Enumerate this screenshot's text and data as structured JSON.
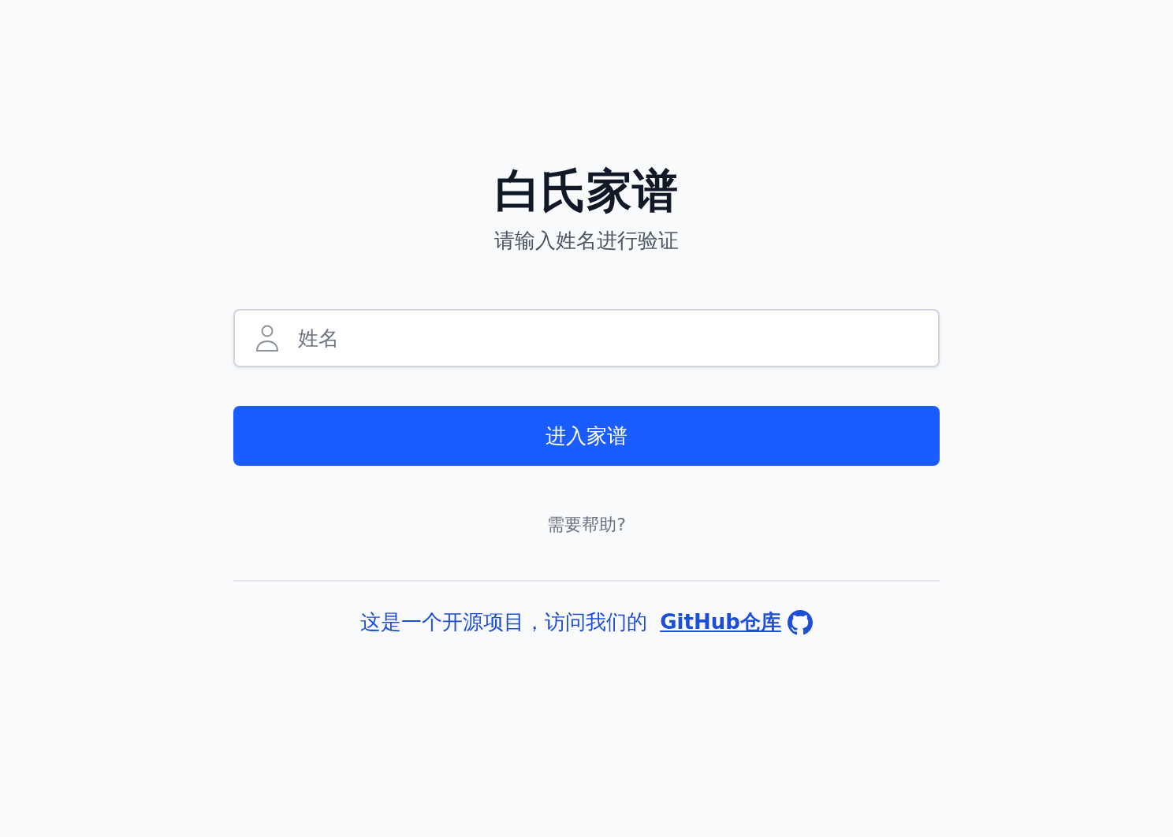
{
  "title": "白氏家谱",
  "subtitle": "请输入姓名进行验证",
  "name_field": {
    "placeholder": "姓名"
  },
  "submit_button": "进入家谱",
  "help_link": "需要帮助?",
  "footer": {
    "text": "这是一个开源项目，访问我们的",
    "link": "GitHub仓库"
  }
}
